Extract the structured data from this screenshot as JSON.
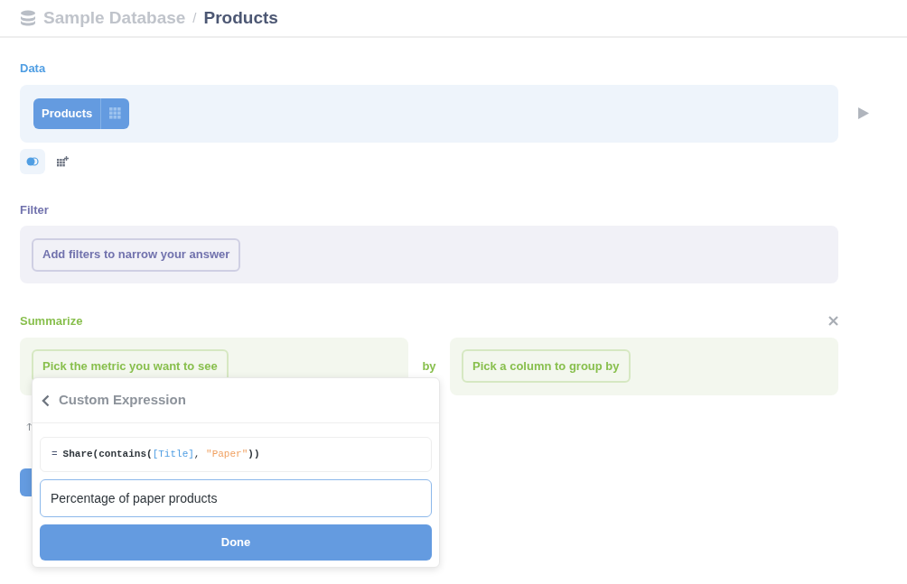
{
  "breadcrumb": {
    "database": "Sample Database",
    "separator": "/",
    "table": "Products"
  },
  "data_section": {
    "label": "Data",
    "table_button": "Products"
  },
  "data_tools": [
    {
      "kind": "join",
      "selected": true
    },
    {
      "kind": "custom-column",
      "selected": false
    }
  ],
  "filter_section": {
    "label": "Filter",
    "button": "Add filters to narrow your answer"
  },
  "summarize_section": {
    "label": "Summarize",
    "metric_button": "Pick the metric you want to see",
    "by": "by",
    "group_button": "Pick a column to group by"
  },
  "popover": {
    "title": "Custom Expression",
    "expression": [
      {
        "kind": "operator",
        "text": "="
      },
      {
        "kind": "function",
        "text": "Share(contains("
      },
      {
        "kind": "field",
        "text": "[Title]"
      },
      {
        "kind": "punct",
        "text": ", "
      },
      {
        "kind": "string",
        "text": "\"Paper\""
      },
      {
        "kind": "function",
        "text": "))"
      }
    ],
    "name_field": {
      "value": "Percentage of paper products",
      "focused": true
    },
    "done_button": "Done"
  }
}
